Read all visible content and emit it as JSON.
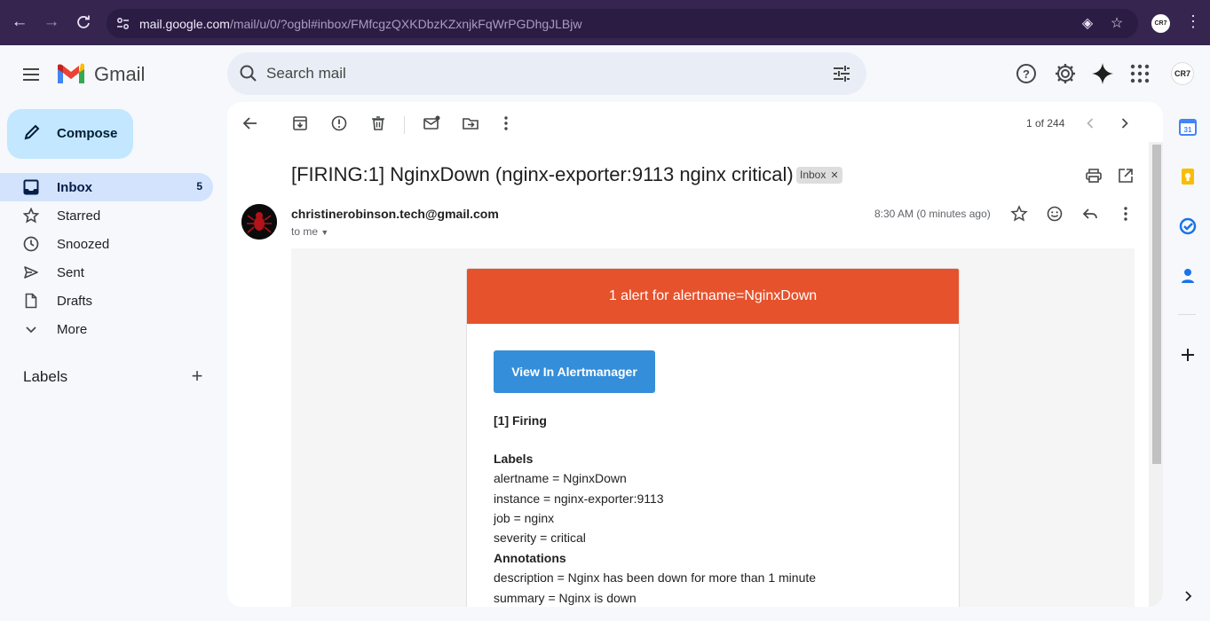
{
  "browser": {
    "url_host": "mail.google.com",
    "url_path": "/mail/u/0/?ogbl#inbox/FMfcgzQXKDbzKZxnjkFqWrPGDhgJLBjw",
    "profile_initials": "CR7"
  },
  "app": {
    "name": "Gmail",
    "search_placeholder": "Search mail",
    "account_initials": "CR7"
  },
  "sidebar": {
    "compose_label": "Compose",
    "items": [
      {
        "label": "Inbox",
        "count": "5",
        "icon": "inbox-icon",
        "active": true
      },
      {
        "label": "Starred",
        "count": "",
        "icon": "star-icon"
      },
      {
        "label": "Snoozed",
        "count": "",
        "icon": "clock-icon"
      },
      {
        "label": "Sent",
        "count": "",
        "icon": "send-icon"
      },
      {
        "label": "Drafts",
        "count": "",
        "icon": "draft-icon"
      },
      {
        "label": "More",
        "count": "",
        "icon": "chevron-down-icon"
      }
    ],
    "labels_heading": "Labels"
  },
  "toolbar": {
    "pager": "1 of 244"
  },
  "message": {
    "subject": "[FIRING:1] NginxDown (nginx-exporter:9113 nginx critical)",
    "label_chip": "Inbox",
    "sender": "christinerobinson.tech@gmail.com",
    "to": "to me",
    "time": "8:30 AM (0 minutes ago)"
  },
  "alert_email": {
    "header": "1 alert for alertname=NginxDown",
    "button": "View In Alertmanager",
    "firing_heading": "[1] Firing",
    "labels_heading": "Labels",
    "labels": [
      "alertname = NginxDown",
      "instance = nginx-exporter:9113",
      "job = nginx",
      "severity = critical"
    ],
    "annotations_heading": "Annotations",
    "annotations": [
      "description = Nginx has been down for more than 1 minute",
      "summary = Nginx is down"
    ]
  },
  "colors": {
    "alert_header": "#e6522c",
    "alert_button": "#348eda",
    "compose_bg": "#c2e7ff",
    "active_nav": "#d3e3fd",
    "chrome_bg": "#35254f"
  }
}
